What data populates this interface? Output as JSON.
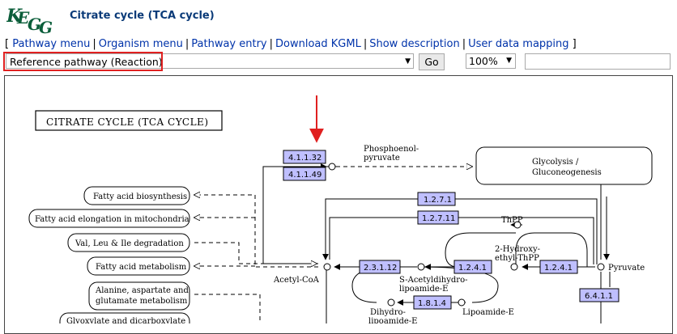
{
  "header": {
    "logo": "KEGG",
    "title": "Citrate cycle (TCA cycle)"
  },
  "menu": {
    "open_bracket": "[",
    "close_bracket": "]",
    "separator": "|",
    "items": [
      "Pathway menu",
      "Organism menu",
      "Pathway entry",
      "Download KGML",
      "Show description",
      "User data mapping"
    ]
  },
  "controls": {
    "pathway_select": "Reference pathway (Reaction)",
    "go_label": "Go",
    "zoom_select": "100%",
    "search_value": ""
  },
  "map": {
    "title": "CITRATE CYCLE (TCA CYCLE)",
    "enzymes": [
      "4.1.1.32",
      "4.1.1.49",
      "1.2.7.1",
      "1.2.7.11",
      "2.3.1.12",
      "1.2.4.1",
      "1.2.4.1",
      "1.8.1.4",
      "6.4.1.1"
    ],
    "pathways": [
      "Glycolysis / Gluconeogenesis",
      "Fatty acid biosynthesis",
      "Fatty acid elongation in mitochondria",
      "Val, Leu & Ile degradation",
      "Fatty acid metabolism",
      "Alanine, aspartate and glutamate metabolism",
      "Glyoxylate and dicarboxylate"
    ],
    "compounds": [
      "Phosphoenol-pyruvate",
      "ThPP",
      "2-Hydroxy-ethyl-ThPP",
      "Pyruvate",
      "Acetyl-CoA",
      "S-Acetyldihydro-lipoamide-E",
      "Dihydro-lipoamide-E",
      "Lipoamide-E"
    ],
    "colors": {
      "enzyme_fill": "#bfbfff",
      "highlight": "#e02020"
    }
  }
}
